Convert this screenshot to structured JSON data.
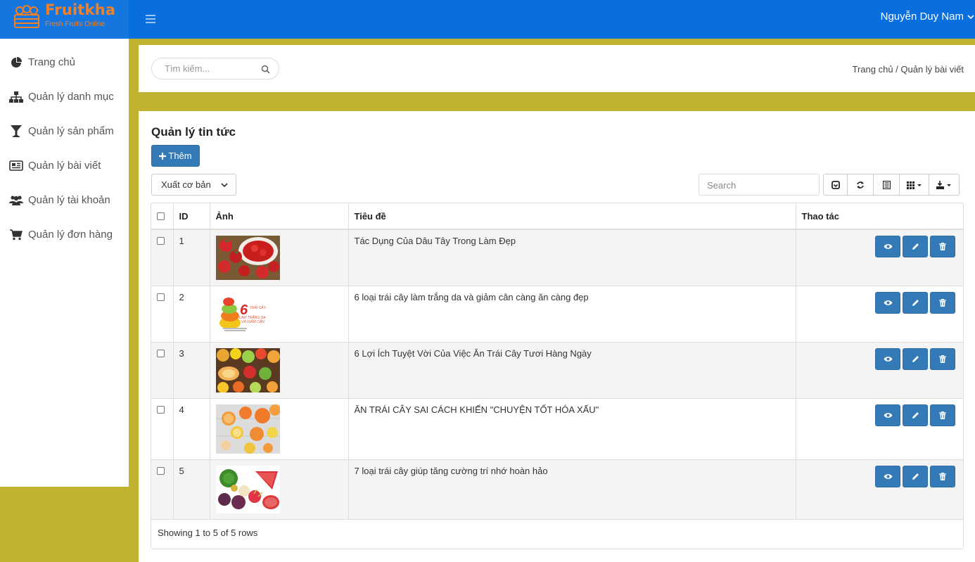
{
  "brand": {
    "name": "Fruitkha",
    "tagline": "Fresh Fruits Online",
    "accent": "#f28123",
    "header_bg": "#0a6fde",
    "page_bg": "#c2b232"
  },
  "header": {
    "user_name": "Nguyễn Duy Nam"
  },
  "sidebar": {
    "items": [
      {
        "label": "Trang chủ",
        "icon": "pie-chart-icon"
      },
      {
        "label": "Quản lý danh mục",
        "icon": "sitemap-icon"
      },
      {
        "label": "Quản lý sản phẩm",
        "icon": "glass-icon"
      },
      {
        "label": "Quản lý bài viết",
        "icon": "newspaper-icon"
      },
      {
        "label": "Quản lý tài khoản",
        "icon": "users-icon"
      },
      {
        "label": "Quản lý đơn hàng",
        "icon": "cart-icon"
      }
    ]
  },
  "search": {
    "placeholder": "Tìm kiếm..."
  },
  "breadcrumb": "Trang chủ / Quản lý bài viết",
  "page": {
    "title": "Quản lý tin tức",
    "add_label": "Thêm",
    "export_label": "Xuất cơ bản",
    "table_search_placeholder": "Search"
  },
  "table": {
    "columns": [
      "ID",
      "Ảnh",
      "Tiêu đề",
      "Thao tác"
    ],
    "rows": [
      {
        "id": "1",
        "title": "Tác Dụng Của Dâu Tây Trong Làm Đẹp",
        "image": "strawberries"
      },
      {
        "id": "2",
        "title": "6 loại trái cây làm trắng da và giảm cân càng ăn càng đẹp",
        "image": "fruit-stack"
      },
      {
        "id": "3",
        "title": "6 Lợi Ích Tuyệt Vời Của Việc Ăn Trái Cây Tươi Hàng Ngày",
        "image": "fruit-platter"
      },
      {
        "id": "4",
        "title": "ĂN TRÁI CÂY SAI CÁCH KHIẾN \"CHUYỆN TỐT HÓA XẤU\"",
        "image": "citrus-slices"
      },
      {
        "id": "5",
        "title": "7 loại trái cây giúp tăng cường trí nhớ hoàn hảo",
        "image": "tropical-fruits"
      }
    ],
    "thumb_overlay": {
      "number": "6",
      "line1": "TRÁI CÂY",
      "line2": "LÀM TRẮNG DA",
      "line3": "VÀ GIẢM CÂN"
    },
    "footer": "Showing 1 to 5 of 5 rows"
  }
}
